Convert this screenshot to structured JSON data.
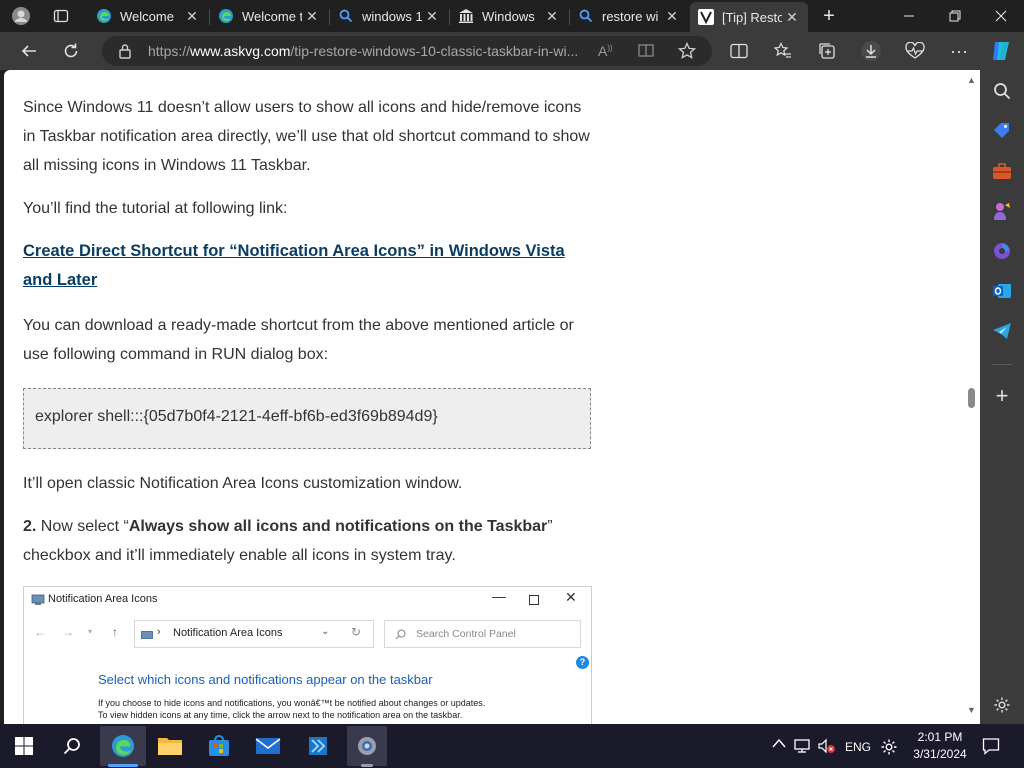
{
  "tabs": [
    {
      "title": "Welcome",
      "icon": "edge-icon",
      "active": false
    },
    {
      "title": "Welcome t",
      "icon": "edge-icon",
      "active": false
    },
    {
      "title": "windows 1",
      "icon": "search-icon",
      "active": false
    },
    {
      "title": "Windows",
      "icon": "bank-icon",
      "active": false
    },
    {
      "title": "restore wi",
      "icon": "search-icon",
      "active": false
    },
    {
      "title": "[Tip] Resto",
      "icon": "askvg-icon",
      "active": true
    }
  ],
  "toolbar": {
    "url_prefix": "https://",
    "url_host": "www.askvg.com",
    "url_path": "/tip-restore-windows-10-classic-taskbar-in-wi..."
  },
  "article": {
    "p1": "Since Windows 11 doesn’t allow users to show all icons and hide/remove icons in Taskbar notification area directly, we’ll use that old shortcut command to show all missing icons in Windows 11 Taskbar.",
    "p2": "You’ll find the tutorial at following link:",
    "link": "Create Direct Shortcut for “Notification Area Icons” in Windows Vista and Later",
    "p3": "You can download a ready-made shortcut from the above mentioned article or use following command in RUN dialog box:",
    "code": "explorer shell:::{05d7b0f4-2121-4eff-bf6b-ed3f69b894d9}",
    "p4": "It’ll open classic Notification Area Icons customization window.",
    "step_num": "2.",
    "step_a": " Now select “",
    "step_bold": "Always show all icons and notifications on the Taskbar",
    "step_b": "” checkbox and it’ll immediately enable all icons in system tray."
  },
  "dialog": {
    "title": "Notification Area Icons",
    "breadcrumb": "Notification Area Icons",
    "search_placeholder": "Search Control Panel",
    "heading": "Select which icons and notifications appear on the taskbar",
    "line1": "If you choose to hide icons and notifications, you wonâ€™t be notified about changes or updates.",
    "line2": "To view hidden icons at any time, click the arrow next to the notification area on the taskbar."
  },
  "taskbar": {
    "language": "ENG",
    "time": "2:01 PM",
    "date": "3/31/2024"
  },
  "colors": {
    "accent": "#0078d4",
    "link": "#0a3d62",
    "dialog_heading": "#1a5fb4"
  }
}
